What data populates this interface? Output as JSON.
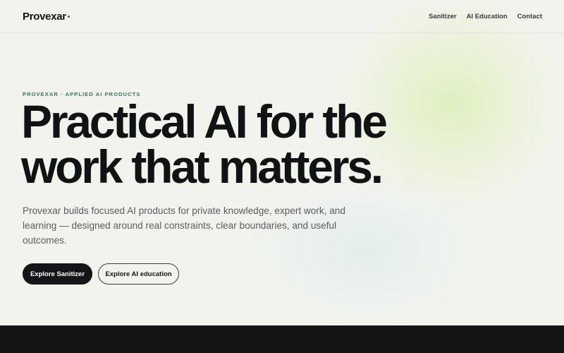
{
  "header": {
    "logo_text": "Provexar",
    "nav": [
      {
        "label": "Sanitizer"
      },
      {
        "label": "AI Education"
      },
      {
        "label": "Contact"
      }
    ]
  },
  "hero": {
    "eyebrow": "PROVEXAR · APPLIED AI PRODUCTS",
    "title_line1": "Practical AI for the",
    "title_line2": "work that matters.",
    "lede": "Provexar builds focused AI products for private knowledge, expert work, and learning — designed around real constraints, clear boundaries, and useful outcomes.",
    "primary_cta": "Explore Sanitizer",
    "secondary_cta": "Explore AI education"
  },
  "colors": {
    "accent": "#2a7a63",
    "ink": "#141516",
    "background": "#f3f3ee"
  }
}
